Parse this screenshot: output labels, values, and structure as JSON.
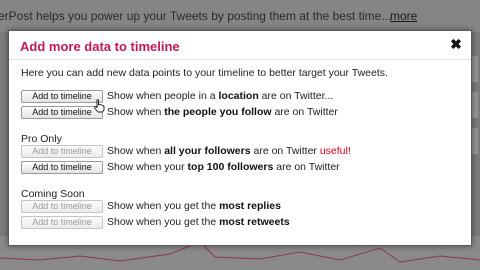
{
  "background": {
    "banner_text": "erPost helps you power up your Tweets by posting them at the best time...",
    "banner_link": "more"
  },
  "modal": {
    "title": "Add more data to timeline",
    "title_color": "#c2185b",
    "close_label": "✖",
    "intro": "Here you can add new data points to your timeline to better target your Tweets.",
    "basic": [
      {
        "button": "Add to timeline",
        "enabled": true,
        "pre": "Show when people in a ",
        "bold": "location",
        "post": " are on Twitter..."
      },
      {
        "button": "Add to timeline",
        "enabled": true,
        "pre": "Show when ",
        "bold": "the people you follow",
        "post": " are on Twitter"
      }
    ],
    "pro": {
      "label": "Pro Only",
      "items": [
        {
          "button": "Add to timeline",
          "enabled": false,
          "pre": "Show when ",
          "bold": "all your followers",
          "post": " are on Twitter ",
          "note": "useful!"
        },
        {
          "button": "Add to timeline",
          "enabled": true,
          "pre": "Show when your ",
          "bold": "top 100 followers",
          "post": " are on Twitter"
        }
      ]
    },
    "soon": {
      "label": "Coming Soon",
      "items": [
        {
          "button": "Add to timeline",
          "enabled": false,
          "pre": "Show when you get the ",
          "bold": "most replies",
          "post": ""
        },
        {
          "button": "Add to timeline",
          "enabled": false,
          "pre": "Show when you get the ",
          "bold": "most retweets",
          "post": ""
        }
      ]
    }
  }
}
